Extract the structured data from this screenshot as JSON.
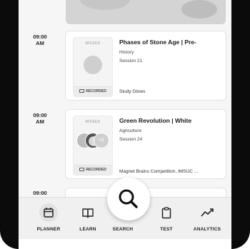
{
  "sessions": [
    {
      "time": "09:00\nAM",
      "status": "MISSED",
      "title": "Phases of Stone Age | Pre-",
      "subject": "History",
      "session": "Session 21",
      "recorded_label": "RECORDED",
      "tag": "Study Glows"
    },
    {
      "time": "09:00\nAM",
      "status": "MISSED",
      "title": "Green Revolution | White",
      "subject": "Agriculture",
      "session": "Session 24",
      "recorded_label": "RECORDED",
      "tag": "Magnet Brains Competition, IMSUC ...",
      "extra_avatars": "+1"
    },
    {
      "time": "09:00"
    }
  ],
  "nav": {
    "items": [
      {
        "label": "PLANNER",
        "icon": "calendar-icon"
      },
      {
        "label": "LEARN",
        "icon": "book-icon"
      },
      {
        "label": "SEARCH",
        "icon": "search-icon"
      },
      {
        "label": "TEST",
        "icon": "clipboard-icon"
      },
      {
        "label": "ANALYTICS",
        "icon": "chart-line-icon"
      }
    ]
  }
}
